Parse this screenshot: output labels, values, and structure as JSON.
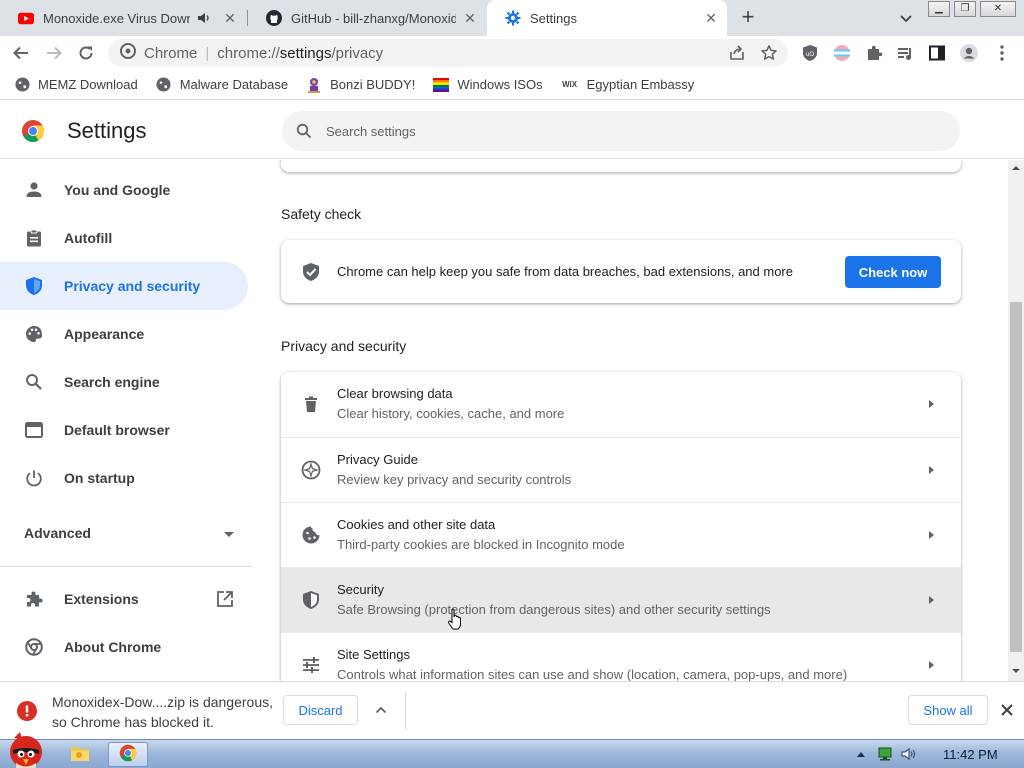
{
  "tabs": [
    {
      "title": "Monoxide.exe Virus Download",
      "icon": "youtube-icon",
      "audio": true,
      "close": "✕"
    },
    {
      "title": "GitHub - bill-zhanxg/Monoxide",
      "icon": "github-icon",
      "close": "✕"
    },
    {
      "title": "Settings",
      "icon": "gear-icon",
      "close": "✕",
      "active": true
    }
  ],
  "new_tab_label": "+",
  "omnibox": {
    "chip": "Chrome",
    "divider": "|",
    "url_prefix": "chrome://",
    "url_host": "settings",
    "url_path": "/privacy"
  },
  "bookmarks": [
    {
      "label": "MEMZ Download",
      "icon": "globe-icon"
    },
    {
      "label": "Malware Database",
      "icon": "globe-icon"
    },
    {
      "label": "Bonzi BUDDY!",
      "icon": "bonzi-icon"
    },
    {
      "label": "Windows ISOs",
      "icon": "rainbow-flag-icon"
    },
    {
      "label": "Egyptian Embassy",
      "icon": "wix-icon",
      "icon_text": "WiX"
    }
  ],
  "settings": {
    "title": "Settings",
    "search_placeholder": "Search settings"
  },
  "sidebar": {
    "items": [
      {
        "label": "You and Google",
        "icon": "person-icon"
      },
      {
        "label": "Autofill",
        "icon": "clipboard-icon"
      },
      {
        "label": "Privacy and security",
        "icon": "shield-icon",
        "active": true
      },
      {
        "label": "Appearance",
        "icon": "palette-icon"
      },
      {
        "label": "Search engine",
        "icon": "search-icon"
      },
      {
        "label": "Default browser",
        "icon": "browser-icon"
      },
      {
        "label": "On startup",
        "icon": "power-icon"
      }
    ],
    "advanced": "Advanced",
    "bottom_items": [
      {
        "label": "Extensions",
        "icon": "puzzle-icon"
      },
      {
        "label": "About Chrome",
        "icon": "chrome-icon"
      }
    ]
  },
  "safety_check": {
    "heading": "Safety check",
    "text": "Chrome can help keep you safe from data breaches, bad extensions, and more",
    "button": "Check now"
  },
  "privacy": {
    "heading": "Privacy and security",
    "rows": [
      {
        "title": "Clear browsing data",
        "subtitle": "Clear history, cookies, cache, and more",
        "icon": "trash-icon"
      },
      {
        "title": "Privacy Guide",
        "subtitle": "Review key privacy and security controls",
        "icon": "compass-icon"
      },
      {
        "title": "Cookies and other site data",
        "subtitle": "Third-party cookies are blocked in Incognito mode",
        "icon": "cookie-icon"
      },
      {
        "title": "Security",
        "subtitle": "Safe Browsing (protection from dangerous sites) and other security settings",
        "icon": "shield-icon",
        "hover": true
      },
      {
        "title": "Site Settings",
        "subtitle": "Controls what information sites can use and show (location, camera, pop-ups, and more)",
        "icon": "sliders-icon"
      }
    ]
  },
  "download_bar": {
    "message": "Monoxidex-Dow....zip is dangerous, so Chrome has blocked it.",
    "discard": "Discard",
    "show_all": "Show all"
  },
  "taskbar": {
    "time": "11:42 PM"
  },
  "colors": {
    "accent": "#1a73e8",
    "active_nav_bg": "#e8f0fe",
    "tab_strip": "#dee1e6",
    "danger": "#d93025"
  }
}
